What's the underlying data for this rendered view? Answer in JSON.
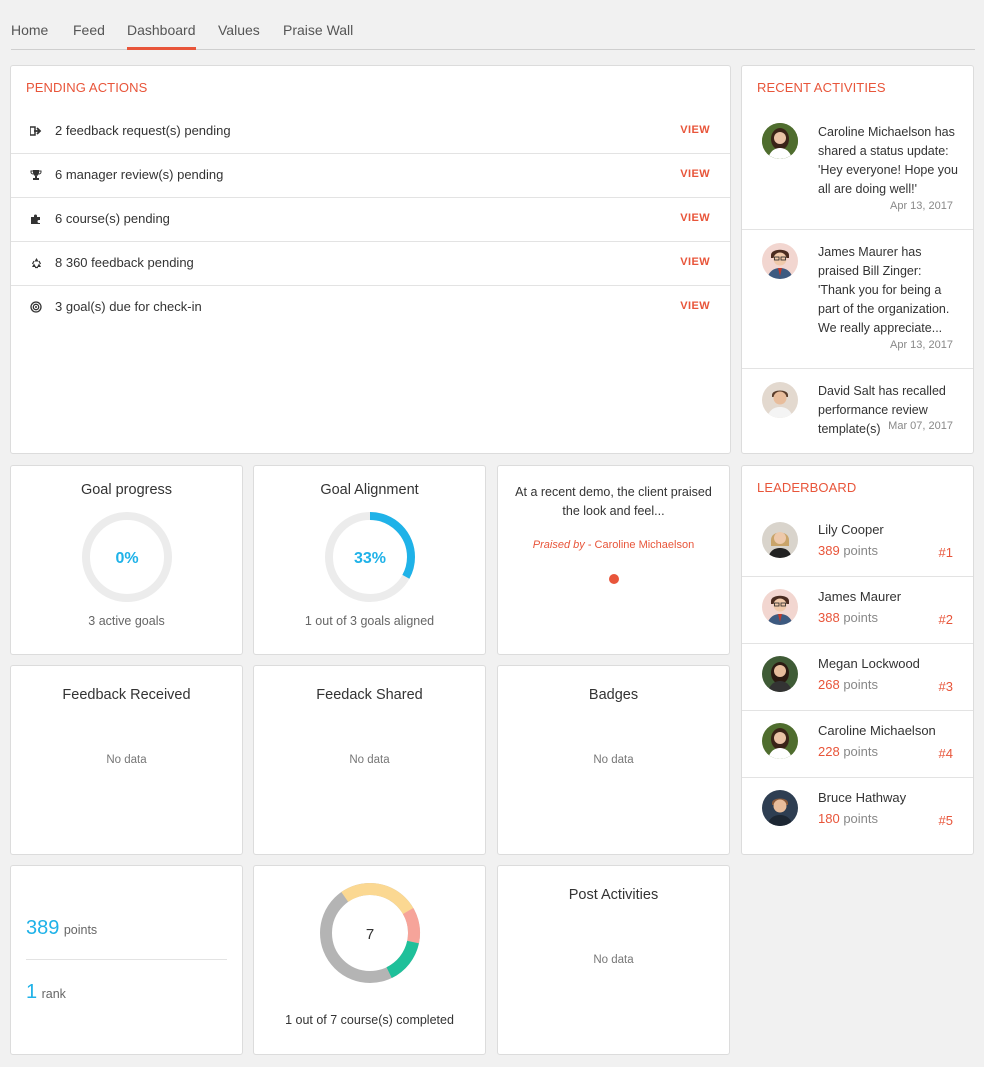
{
  "nav": {
    "tabs": [
      {
        "label": "Home"
      },
      {
        "label": "Feed"
      },
      {
        "label": "Dashboard"
      },
      {
        "label": "Values"
      },
      {
        "label": "Praise Wall"
      }
    ],
    "active": "Dashboard"
  },
  "pending": {
    "title": "PENDING ACTIONS",
    "view_label": "VIEW",
    "items": [
      {
        "text": "2 feedback request(s) pending",
        "icon": "sign-out-icon"
      },
      {
        "text": "6 manager review(s) pending",
        "icon": "trophy-icon"
      },
      {
        "text": "6 course(s) pending",
        "icon": "puzzle-icon"
      },
      {
        "text": "8 360 feedback pending",
        "icon": "recycle-icon"
      },
      {
        "text": "3 goal(s) due for check-in",
        "icon": "target-icon"
      }
    ]
  },
  "recent": {
    "title": "RECENT ACTIVITIES",
    "items": [
      {
        "text": "Caroline Michaelson has shared a status update: 'Hey everyone! Hope you all are doing well!'",
        "date": "Apr 13, 2017"
      },
      {
        "text": "James Maurer has praised Bill Zinger: 'Thank you for being a part of the organization. We really appreciate...",
        "date": "Apr 13, 2017"
      },
      {
        "text": "David Salt has recalled performance review template(s)",
        "date": "Mar 07, 2017"
      }
    ]
  },
  "goal_progress": {
    "title": "Goal progress",
    "value_label": "0%",
    "value": 0,
    "sub": "3 active goals"
  },
  "goal_alignment": {
    "title": "Goal Alignment",
    "value_label": "33%",
    "value": 33,
    "sub": "1 out of 3 goals aligned"
  },
  "praise": {
    "text": "At a recent demo, the client praised the look and feel...",
    "by_label": "Praised by",
    "by_name": "- Caroline Michaelson"
  },
  "feedback_received": {
    "title": "Feedback Received",
    "nodata": "No data"
  },
  "feedback_shared": {
    "title": "Feedack Shared",
    "nodata": "No data"
  },
  "badges": {
    "title": "Badges",
    "nodata": "No data"
  },
  "points": {
    "value": "389",
    "label": "points",
    "rank_value": "1",
    "rank_label": "rank"
  },
  "courses": {
    "center": "7",
    "sub": "1 out of 7 course(s) completed"
  },
  "post_activities": {
    "title": "Post Activities",
    "nodata": "No data"
  },
  "leaderboard": {
    "title": "LEADERBOARD",
    "points_label": "points",
    "rows": [
      {
        "name": "Lily Cooper",
        "points": "389",
        "rank": "#1"
      },
      {
        "name": "James Maurer",
        "points": "388",
        "rank": "#2"
      },
      {
        "name": "Megan Lockwood",
        "points": "268",
        "rank": "#3"
      },
      {
        "name": "Caroline Michaelson",
        "points": "228",
        "rank": "#4"
      },
      {
        "name": "Bruce Hathway",
        "points": "180",
        "rank": "#5"
      }
    ]
  },
  "colors": {
    "accent": "#e8553a",
    "blue": "#1fb2e8",
    "ring_bg": "#ececec"
  }
}
